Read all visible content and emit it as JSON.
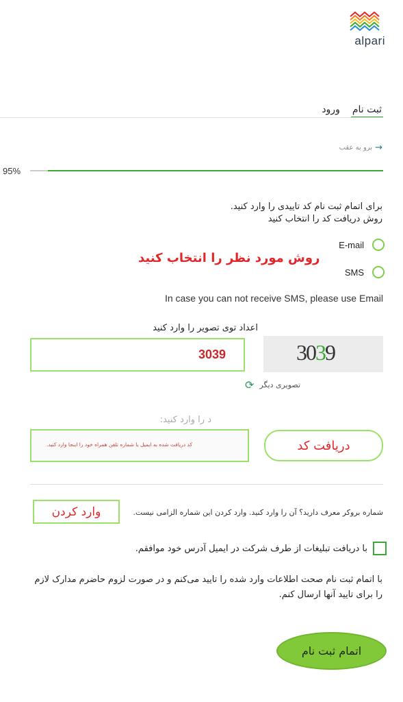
{
  "brand": {
    "logo_text": "alpari"
  },
  "tabs": [
    {
      "label": "ورود"
    },
    {
      "label": "ثبت نام",
      "active": true
    }
  ],
  "back_link": "برو به عقب",
  "progress": {
    "label": "95%",
    "value": 95
  },
  "instructions": {
    "line1": "برای اتمام ثبت نام کد تاییدی را وارد کنید.",
    "line2": "روش دریافت کد را انتخاب کنید"
  },
  "methods": {
    "email_label": "E-mail",
    "sms_label": "SMS",
    "annotation": "روش مورد نظر را انتخاب کنید"
  },
  "sms_note": "In case you can not receive SMS, please use Email",
  "captcha": {
    "label": "اعداد توی تصویر را وارد کنید",
    "input_value": "3039",
    "image_text_a": "30",
    "image_text_b": "3",
    "image_text_c": "9",
    "refresh_label": "تصویری دیگر"
  },
  "code": {
    "label": "د را وارد کنید:",
    "placeholder": "کد دریافت شده  به ایمیل یا شماره تلفن همراه خود را اینجا وارد کنید.",
    "get_code_label": "دریافت کد"
  },
  "referral": {
    "text": "شماره بروکر معرف دارید؟ آن را وارد کنید. وارد کردن این شماره الزامی نیست.",
    "button_label": "وارد کردن"
  },
  "ads_consent": "با دریافت تبلیغات از طرف شرکت در ایمیل آدرس خود موافقم.",
  "terms": "با اتمام ثبت نام صحت اطلاعات وارد شده را تایید می‌کنم و در صورت لزوم حاضرم مدارک لازم را برای تایید آنها ارسال کنم.",
  "submit_label": "اتمام ثبت نام",
  "colors": {
    "accent": "#3aaa35",
    "annotation": "#e3262a",
    "highlight_border": "#9be067",
    "submit_bg": "#82c93a"
  }
}
